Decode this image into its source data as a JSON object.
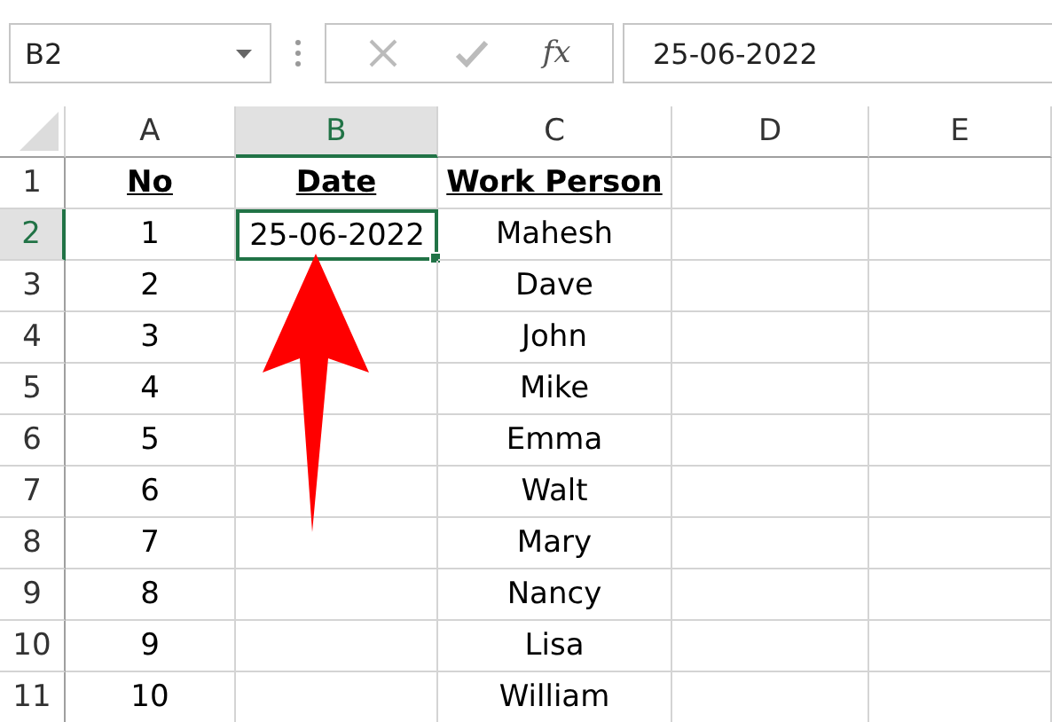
{
  "formula_bar": {
    "name_box": "B2",
    "function_label": "fx",
    "value": "25-06-2022"
  },
  "columns": [
    {
      "label": "A",
      "selected": false
    },
    {
      "label": "B",
      "selected": true
    },
    {
      "label": "C",
      "selected": false
    },
    {
      "label": "D",
      "selected": false
    },
    {
      "label": "E",
      "selected": false
    }
  ],
  "rows": [
    {
      "label": "1",
      "selected": false,
      "kind": "heading",
      "cells": [
        {
          "text": "No",
          "selected": false
        },
        {
          "text": "Date",
          "selected": false
        },
        {
          "text": "Work Person",
          "selected": false
        }
      ]
    },
    {
      "label": "2",
      "selected": true,
      "kind": "data",
      "cells": [
        {
          "text": "1",
          "selected": false
        },
        {
          "text": "25-06-2022",
          "selected": true
        },
        {
          "text": "Mahesh",
          "selected": false
        }
      ]
    },
    {
      "label": "3",
      "selected": false,
      "kind": "data",
      "cells": [
        {
          "text": "2",
          "selected": false
        },
        {
          "selected": false
        },
        {
          "text": "Dave",
          "selected": false
        }
      ]
    },
    {
      "label": "4",
      "selected": false,
      "kind": "data",
      "cells": [
        {
          "text": "3",
          "selected": false
        },
        {
          "selected": false
        },
        {
          "text": "John",
          "selected": false
        }
      ]
    },
    {
      "label": "5",
      "selected": false,
      "kind": "data",
      "cells": [
        {
          "text": "4",
          "selected": false
        },
        {
          "selected": false
        },
        {
          "text": "Mike",
          "selected": false
        }
      ]
    },
    {
      "label": "6",
      "selected": false,
      "kind": "data",
      "cells": [
        {
          "text": "5",
          "selected": false
        },
        {
          "selected": false
        },
        {
          "text": "Emma",
          "selected": false
        }
      ]
    },
    {
      "label": "7",
      "selected": false,
      "kind": "data",
      "cells": [
        {
          "text": "6",
          "selected": false
        },
        {
          "selected": false
        },
        {
          "text": "Walt",
          "selected": false
        }
      ]
    },
    {
      "label": "8",
      "selected": false,
      "kind": "data",
      "cells": [
        {
          "text": "7",
          "selected": false
        },
        {
          "selected": false
        },
        {
          "text": "Mary",
          "selected": false
        }
      ]
    },
    {
      "label": "9",
      "selected": false,
      "kind": "data",
      "cells": [
        {
          "text": "8",
          "selected": false
        },
        {
          "selected": false
        },
        {
          "text": "Nancy",
          "selected": false
        }
      ]
    },
    {
      "label": "10",
      "selected": false,
      "kind": "data",
      "cells": [
        {
          "text": "9",
          "selected": false
        },
        {
          "selected": false
        },
        {
          "text": "Lisa",
          "selected": false
        }
      ]
    },
    {
      "label": "11",
      "selected": false,
      "kind": "data",
      "cells": [
        {
          "text": "10",
          "selected": false
        },
        {
          "selected": false
        },
        {
          "text": "William",
          "selected": false
        }
      ]
    }
  ]
}
